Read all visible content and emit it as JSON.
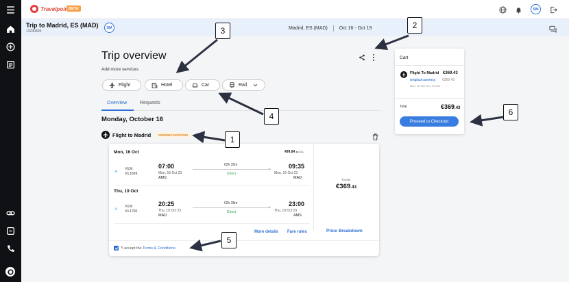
{
  "header": {
    "logo_text": "Travelpoint",
    "beta_label": "BETA",
    "avatar_initials": "SM"
  },
  "trip": {
    "title": "Trip to Madrid, ES (MAD)",
    "code": "13230605",
    "avatar_initials": "SM",
    "destination": "Madrid, ES (MAD)",
    "dates": "Oct 16 - Oct 19"
  },
  "overview": {
    "title": "Trip overview",
    "add_more": "Add more services",
    "services": [
      {
        "label": "Flight",
        "icon": "airplane-icon"
      },
      {
        "label": "Hotel",
        "icon": "hotel-icon"
      },
      {
        "label": "Car",
        "icon": "car-icon"
      },
      {
        "label": "Rail",
        "icon": "train-icon"
      }
    ],
    "tabs": [
      "Overview",
      "Requests"
    ],
    "date_heading": "Monday, October 16"
  },
  "flight": {
    "title": "Flight to Madrid",
    "status": "PENDING BOOKING",
    "price_small": "499.84",
    "price_small_unit": "kg CO₂",
    "legs": [
      {
        "date": "Mon, 16 Oct",
        "airline": "KLM",
        "flight_no": "KL1699",
        "dep_time": "07:00",
        "dep_date": "Mon, 16 Oct 23",
        "dep_code": "AMS",
        "duration": "02h 35m",
        "stops": "Direct",
        "arr_time": "09:35",
        "arr_date": "Mon, 16 Oct 23",
        "arr_code": "MAD"
      },
      {
        "date": "Thu, 19 Oct",
        "airline": "KLM",
        "flight_no": "KL1706",
        "dep_time": "20:25",
        "dep_date": "Thu, 19 Oct 23",
        "dep_code": "MAD",
        "duration": "02h 35m",
        "stops": "Direct",
        "arr_time": "23:00",
        "arr_date": "Thu, 19 Oct 23",
        "arr_code": "AMS"
      }
    ],
    "to_pay_label": "To pay",
    "to_pay_main": "€369",
    "to_pay_cents": ".43",
    "more_details": "More details",
    "fare_rules": "Fare rules",
    "price_breakdown": "Price Breakdown",
    "terms_prefix": "*I accept the ",
    "terms_link": "Terms & Conditions"
  },
  "cart": {
    "title": "Cart",
    "item_title": "Flight To Madrid",
    "item_price": "€369.43",
    "original_currency_label": "Original currency",
    "original_currency_value": "€369.43",
    "item_dates": "Mon, 16 Oct Thu, 19 Oct",
    "total_label": "Total",
    "total_main": "€369",
    "total_cents": ".43",
    "checkout_label": "Proceed to Checkout"
  },
  "callouts": [
    "1",
    "2",
    "3",
    "4",
    "5",
    "6"
  ],
  "colors": {
    "accent": "#2d6fd6",
    "brand": "#e34b3c",
    "pending": "#e08a2a",
    "direct": "#2ea653"
  }
}
